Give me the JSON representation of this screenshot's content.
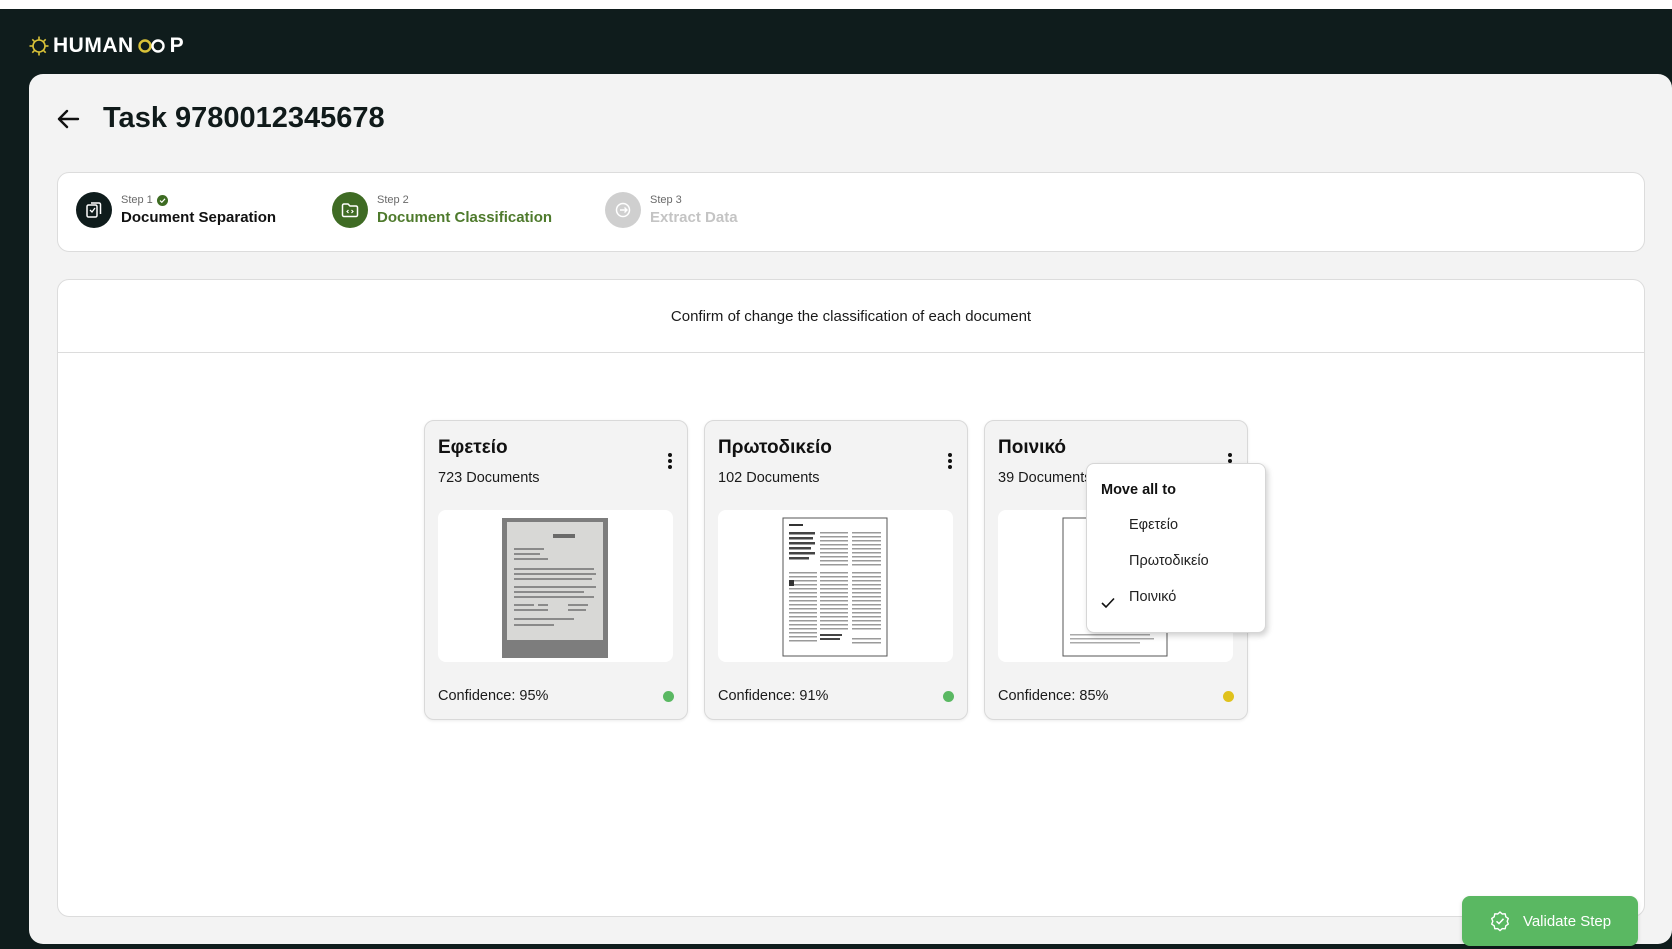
{
  "brand": {
    "logo_text_left": "HUMAN",
    "logo_text_right": "P",
    "accent": "#4e7a2c"
  },
  "header": {
    "title": "Task 9780012345678"
  },
  "steps": [
    {
      "meta": "Step 1",
      "title": "Document Separation",
      "state": "complete",
      "icon": "documents-icon"
    },
    {
      "meta": "Step 2",
      "title": "Document Classification",
      "state": "active",
      "icon": "folder-code-icon"
    },
    {
      "meta": "Step 3",
      "title": "Extract Data",
      "state": "pending",
      "icon": "export-icon"
    }
  ],
  "content": {
    "instruction": "Confirm of change the classification of each document"
  },
  "cards": [
    {
      "title": "Εφετείο",
      "count": "723 Documents",
      "confidence": "Confidence: 95%",
      "confidence_value": 95,
      "status_color": "#5ab862"
    },
    {
      "title": "Πρωτοδικείο",
      "count": "102 Documents",
      "confidence": "Confidence: 91%",
      "confidence_value": 91,
      "status_color": "#5ab862"
    },
    {
      "title": "Ποινικό",
      "count": "39 Documents",
      "confidence": "Confidence: 85%",
      "confidence_value": 85,
      "status_color": "#e0c21c"
    }
  ],
  "menu": {
    "heading": "Move all to",
    "items": [
      {
        "label": "Εφετείο",
        "checked": false
      },
      {
        "label": "Πρωτοδικείο",
        "checked": false
      },
      {
        "label": "Ποινικό",
        "checked": true
      }
    ]
  },
  "actions": {
    "validate_label": "Validate Step"
  }
}
